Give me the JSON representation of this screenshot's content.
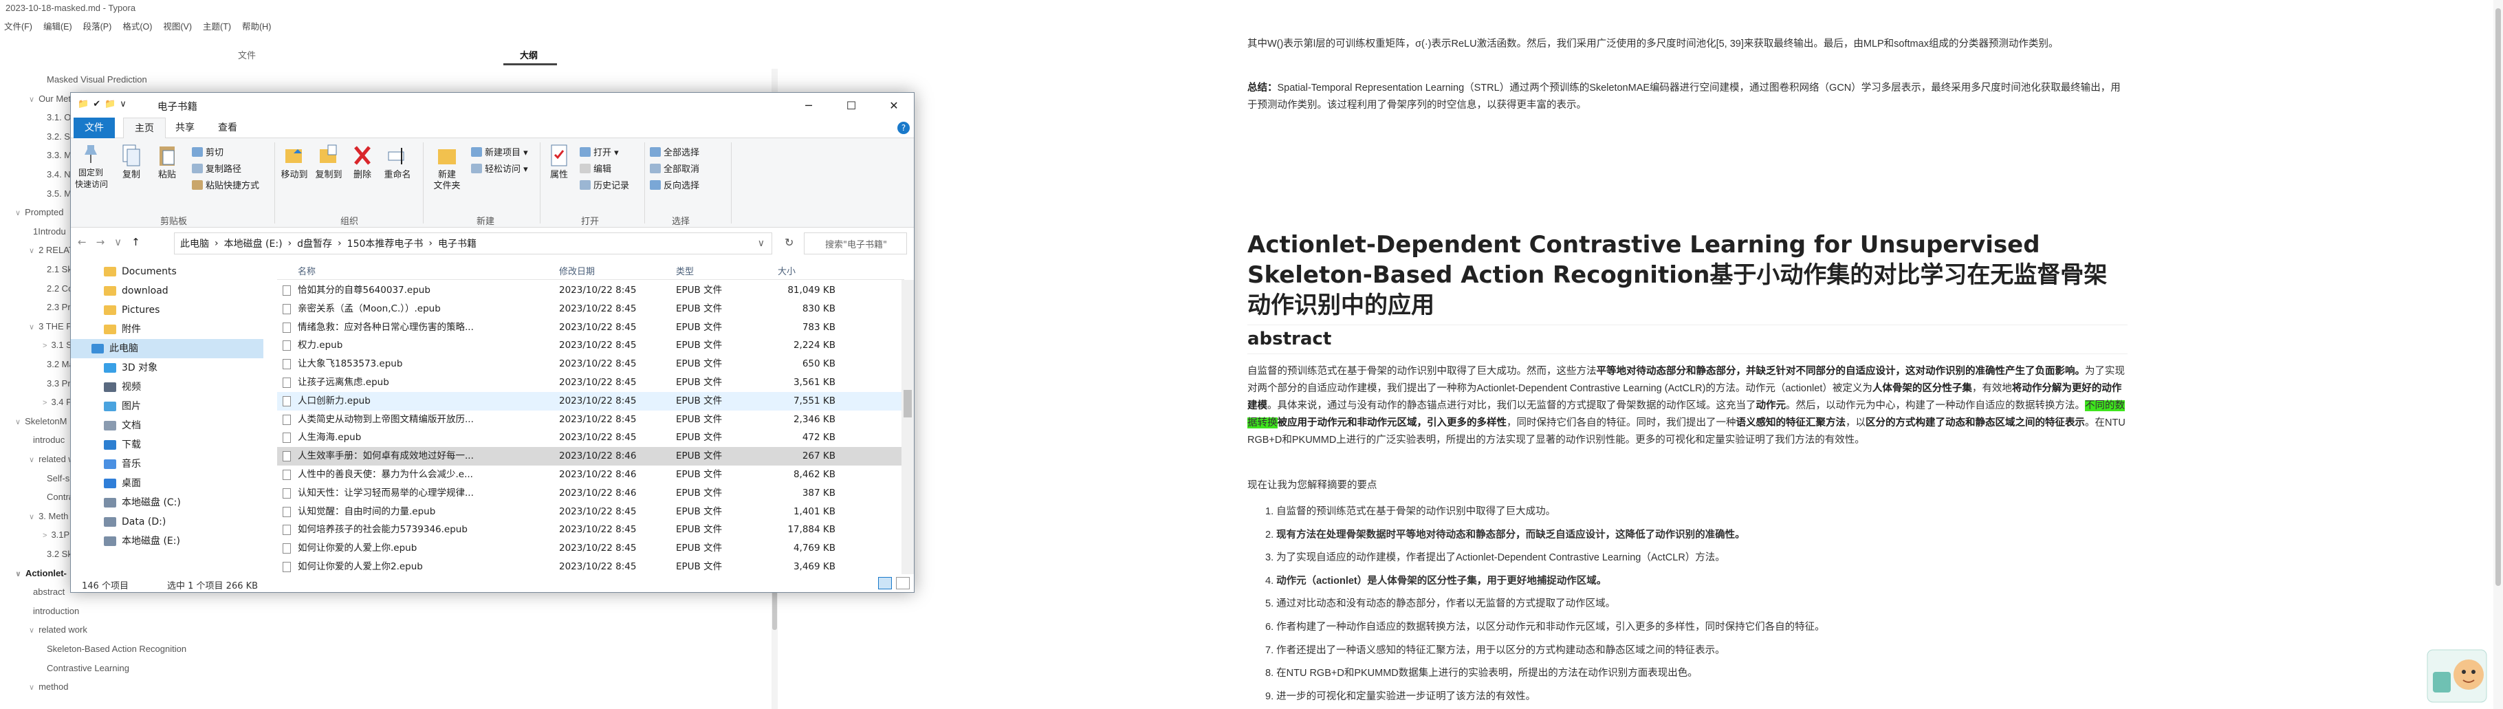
{
  "app": {
    "title": "2023-10-18-masked.md - Typora",
    "window_controls": [
      "─",
      "☐",
      "✕"
    ]
  },
  "menu": [
    "文件(F)",
    "编辑(E)",
    "段落(P)",
    "格式(O)",
    "视图(V)",
    "主题(T)",
    "帮助(H)"
  ],
  "sidebar": {
    "tabs": [
      "文件",
      "大纲"
    ],
    "active_tab": "大纲",
    "outline": [
      {
        "label": "Masked Visual Prediction",
        "indent": 2,
        "caret": ""
      },
      {
        "label": "Our Met",
        "indent": 1,
        "caret": "∨"
      },
      {
        "label": "3.1. O",
        "indent": 2,
        "caret": ""
      },
      {
        "label": "3.2. S",
        "indent": 2,
        "caret": ""
      },
      {
        "label": "3.3. M",
        "indent": 2,
        "caret": ""
      },
      {
        "label": "3.4. N",
        "indent": 2,
        "caret": ""
      },
      {
        "label": "3.5. M",
        "indent": 2,
        "caret": ""
      },
      {
        "label": "Prompted",
        "indent": 0,
        "caret": "∨"
      },
      {
        "label": "1Introdu",
        "indent": 1,
        "caret": ""
      },
      {
        "label": "2 RELATE",
        "indent": 1,
        "caret": "∨"
      },
      {
        "label": "2.1 Sk",
        "indent": 2,
        "caret": ""
      },
      {
        "label": "2.2 Co",
        "indent": 2,
        "caret": ""
      },
      {
        "label": "2.3 Pr",
        "indent": 2,
        "caret": ""
      },
      {
        "label": "3 THE PR",
        "indent": 1,
        "caret": "∨"
      },
      {
        "label": "3.1 Sk",
        "indent": 2,
        "caret": ">"
      },
      {
        "label": "3.2 Ma",
        "indent": 2,
        "caret": ""
      },
      {
        "label": "3.3 Pr",
        "indent": 2,
        "caret": ""
      },
      {
        "label": "3.4 Pr",
        "indent": 2,
        "caret": ">"
      },
      {
        "label": "SkeletonM",
        "indent": 0,
        "caret": "∨"
      },
      {
        "label": "introduc",
        "indent": 1,
        "caret": ""
      },
      {
        "label": "related w",
        "indent": 1,
        "caret": "∨"
      },
      {
        "label": "Self-su",
        "indent": 2,
        "caret": ""
      },
      {
        "label": "Contra",
        "indent": 2,
        "caret": ""
      },
      {
        "label": "3. Meth",
        "indent": 1,
        "caret": "∨"
      },
      {
        "label": "3.1Pre",
        "indent": 2,
        "caret": ">"
      },
      {
        "label": "3.2 Sk",
        "indent": 2,
        "caret": ""
      },
      {
        "label": "Actionlet-",
        "indent": 0,
        "caret": "∨",
        "selected": true
      },
      {
        "label": "abstract",
        "indent": 1,
        "caret": ""
      },
      {
        "label": "introduction",
        "indent": 1,
        "caret": ""
      },
      {
        "label": "related work",
        "indent": 1,
        "caret": "∨"
      },
      {
        "label": "Skeleton-Based Action Recognition",
        "indent": 2,
        "caret": ""
      },
      {
        "label": "Contrastive Learning",
        "indent": 2,
        "caret": ""
      },
      {
        "label": "method",
        "indent": 1,
        "caret": "∨"
      }
    ],
    "bottom_icons": [
      "<",
      "/>"
    ]
  },
  "document": {
    "top_para": "其中W()表示第l层的可训练权重矩阵，σ(·)表示ReLU激活函数。然后，我们采用广泛使用的多尺度时间池化[5, 39]来获取最终输出。最后，由MLP和softmax组成的分类器预测动作类别。",
    "summary_label": "总结：",
    "summary_text": "Spatial-Temporal Representation Learning（STRL）通过两个预训练的SkeletonMAE编码器进行空间建模，通过图卷积网络（GCN）学习多层表示，最终采用多尺度时间池化获取最终输出，用于预测动作类别。该过程利用了骨架序列的时空信息，以获得更丰富的表示。",
    "heading": "Actionlet-Dependent Contrastive Learning for Unsupervised Skeleton-Based Action Recognition基于小动作集的对比学习在无监督骨架动作识别中的应用",
    "abstract_heading": "abstract",
    "abstract": {
      "t1": "自监督的预训练范式在基于骨架的动作识别中取得了巨大成功。然而，这些方法",
      "b1": "平等地对待动态部分和静态部分，并缺乏针对不同部分的自适应设计，这对动作识别的准确性产生了负面影响。",
      "t2": "为了实现对两个部分的自适应动作建模，我们提出了一种称为Actionlet-Dependent Contrastive Learning (ActCLR)的方法。动作元（actionlet）被定义为",
      "b2": "人体骨架的区分性子集",
      "t3": "，有效地",
      "b3": "将动作分解为更好的动作建模",
      "t4": "。具体来说，通过与没有动作的静态锚点进行对比，我们以无监督的方式提取了骨架数据的动作区域。这充当了",
      "b4": "动作元",
      "t5": "。然后，以动作元为中心，构建了一种动作自适应的数据转换方法。",
      "hl": "不同的数据转换",
      "b5": "被应用于动作元和非动作元区域，引入更多的多样性",
      "t6": "，同时保持它们各自的特征。同时，我们提出了一种",
      "b6": "语义感知的特征汇聚方法",
      "t7": "，以",
      "b7": "区分的方式构建了动态和静态区域之间的特征表示",
      "t8": "。在NTU RGB+D和PKUMMD上进行的广泛实验表明，所提出的方法实现了显著的动作识别性能。更多的可视化和定量实验证明了我们方法的有效性。"
    },
    "points_intro": "现在让我为您解释摘要的要点",
    "points": [
      "自监督的预训练范式在基于骨架的动作识别中取得了巨大成功。",
      "现有方法在处理骨架数据时平等地对待动态和静态部分，而缺乏自适应设计，这降低了动作识别的准确性。",
      "为了实现自适应的动作建模，作者提出了Actionlet-Dependent Contrastive Learning（ActCLR）方法。",
      "动作元（actionlet）是人体骨架的区分性子集，用于更好地捕捉动作区域。",
      "通过对比动态和没有动态的静态部分，作者以无监督的方式提取了动作区域。",
      "作者构建了一种动作自适应的数据转换方法，以区分动作元和非动作元区域，引入更多的多样性，同时保持它们各自的特征。",
      "作者还提出了一种语义感知的特征汇聚方法，用于以区分的方式构建动态和静态区域之间的特征表示。",
      "在NTU RGB+D和PKUMMD数据集上进行的实验表明，所提出的方法在动作识别方面表现出色。",
      "进一步的可视化和定量实验进一步证明了该方法的有效性。"
    ],
    "points_bold": [
      false,
      true,
      false,
      true,
      false,
      false,
      false,
      false,
      false
    ],
    "highlight_color": "#3ee51d"
  },
  "explorer": {
    "title": "电子书籍",
    "quick_access_glyphs": [
      "📁",
      "✔",
      "📁",
      "∨"
    ],
    "win_controls": [
      "─",
      "☐",
      "✕"
    ],
    "tabs": [
      "文件",
      "主页",
      "共享",
      "查看"
    ],
    "ribbon": {
      "pin_label": "固定到\n快速访问",
      "copy_label": "复制",
      "paste_label": "粘贴",
      "cut": "剪切",
      "copy_path": "复制路径",
      "paste_shortcut": "粘贴快捷方式",
      "move_to": "移动到",
      "copy_to": "复制到",
      "delete": "删除",
      "rename": "重命名",
      "new_folder": "新建\n文件夹",
      "new_item": "新建项目 ▾",
      "easy_access": "轻松访问 ▾",
      "properties": "属性",
      "open": "打开 ▾",
      "edit": "编辑",
      "history": "历史记录",
      "select_all": "全部选择",
      "select_none": "全部取消",
      "invert": "反向选择",
      "groups": [
        "剪贴板",
        "组织",
        "新建",
        "打开",
        "选择"
      ]
    },
    "address": {
      "nav": [
        "←",
        "→",
        "∨",
        "↑"
      ],
      "path": [
        "此电脑",
        "本地磁盘 (E:)",
        "d盘暂存",
        "150本推荐电子书",
        "电子书籍"
      ],
      "separator": "›",
      "refresh": "↻",
      "search_placeholder": "搜索\"电子书籍\""
    },
    "nav": [
      {
        "label": "Documents",
        "indent": 1,
        "color": "#f2c14e"
      },
      {
        "label": "download",
        "indent": 1,
        "color": "#f2c14e"
      },
      {
        "label": "Pictures",
        "indent": 1,
        "color": "#f2c14e"
      },
      {
        "label": "附件",
        "indent": 1,
        "color": "#f2c14e"
      },
      {
        "label": "此电脑",
        "indent": 0,
        "color": "#3b8ed8",
        "sel": true
      },
      {
        "label": "3D 对象",
        "indent": 1,
        "color": "#39a0e6"
      },
      {
        "label": "视频",
        "indent": 1,
        "color": "#5a6a80"
      },
      {
        "label": "图片",
        "indent": 1,
        "color": "#4aa3df"
      },
      {
        "label": "文档",
        "indent": 1,
        "color": "#8a9bb0"
      },
      {
        "label": "下载",
        "indent": 1,
        "color": "#2d7fd1"
      },
      {
        "label": "音乐",
        "indent": 1,
        "color": "#4a90e2"
      },
      {
        "label": "桌面",
        "indent": 1,
        "color": "#2f7ed8"
      },
      {
        "label": "本地磁盘 (C:)",
        "indent": 1,
        "color": "#7a8ea6"
      },
      {
        "label": "Data (D:)",
        "indent": 1,
        "color": "#7a8ea6"
      },
      {
        "label": "本地磁盘 (E:)",
        "indent": 1,
        "color": "#7a8ea6"
      }
    ],
    "columns": [
      "名称",
      "修改日期",
      "类型",
      "大小"
    ],
    "files": [
      {
        "name": "恰如其分的自尊5640037.epub",
        "date": "2023/10/22 8:45",
        "type": "EPUB 文件",
        "size": "81,049 KB"
      },
      {
        "name": "亲密关系（孟（Moon,C.））.epub",
        "date": "2023/10/22 8:45",
        "type": "EPUB 文件",
        "size": "830 KB"
      },
      {
        "name": "情绪急救：应对各种日常心理伤害的策略...",
        "date": "2023/10/22 8:45",
        "type": "EPUB 文件",
        "size": "783 KB"
      },
      {
        "name": "权力.epub",
        "date": "2023/10/22 8:45",
        "type": "EPUB 文件",
        "size": "2,224 KB"
      },
      {
        "name": "让大象飞1853573.epub",
        "date": "2023/10/22 8:45",
        "type": "EPUB 文件",
        "size": "650 KB"
      },
      {
        "name": "让孩子远离焦虑.epub",
        "date": "2023/10/22 8:45",
        "type": "EPUB 文件",
        "size": "3,561 KB"
      },
      {
        "name": "人口创新力.epub",
        "date": "2023/10/22 8:45",
        "type": "EPUB 文件",
        "size": "7,551 KB",
        "state": "hov"
      },
      {
        "name": "人类简史从动物到上帝图文精编版开放历...",
        "date": "2023/10/22 8:45",
        "type": "EPUB 文件",
        "size": "2,346 KB"
      },
      {
        "name": "人生海海.epub",
        "date": "2023/10/22 8:45",
        "type": "EPUB 文件",
        "size": "472 KB"
      },
      {
        "name": "人生效率手册：如何卓有成效地过好每一...",
        "date": "2023/10/22 8:46",
        "type": "EPUB 文件",
        "size": "267 KB",
        "state": "sel"
      },
      {
        "name": "人性中的善良天使：暴力为什么会减少.e...",
        "date": "2023/10/22 8:46",
        "type": "EPUB 文件",
        "size": "8,462 KB"
      },
      {
        "name": "认知天性：让学习轻而易举的心理学规律...",
        "date": "2023/10/22 8:46",
        "type": "EPUB 文件",
        "size": "387 KB"
      },
      {
        "name": "认知觉醒：自由时间的力量.epub",
        "date": "2023/10/22 8:45",
        "type": "EPUB 文件",
        "size": "1,401 KB"
      },
      {
        "name": "如何培养孩子的社会能力5739346.epub",
        "date": "2023/10/22 8:45",
        "type": "EPUB 文件",
        "size": "17,884 KB"
      },
      {
        "name": "如何让你爱的人爱上你.epub",
        "date": "2023/10/22 8:45",
        "type": "EPUB 文件",
        "size": "4,769 KB"
      },
      {
        "name": "如何让你爱的人爱上你2.epub",
        "date": "2023/10/22 8:45",
        "type": "EPUB 文件",
        "size": "3,469 KB"
      }
    ],
    "status_count": "146 个项目",
    "status_sel": "选中 1 个项目  266 KB"
  }
}
